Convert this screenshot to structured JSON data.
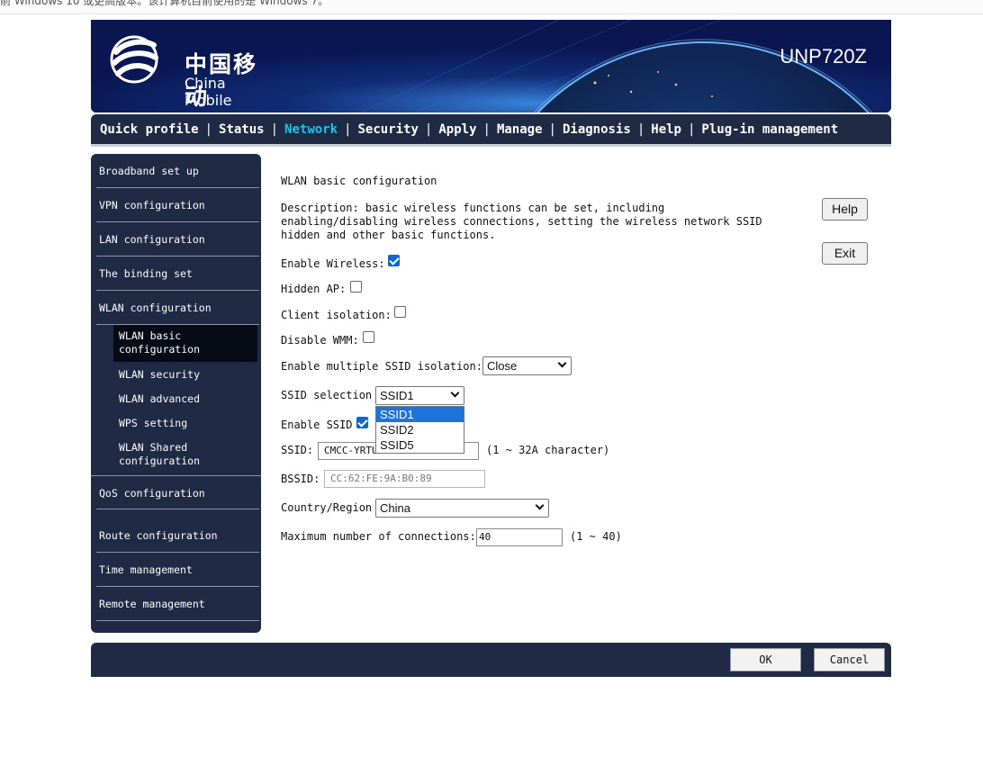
{
  "notice": {
    "text": "前 Windows 10 或更高版本。该计算机目前使用的是 Windows 7。"
  },
  "banner": {
    "brand_cn": "中国移动",
    "brand_en": "China Mobile",
    "model": "UNP720Z",
    "colors": {
      "background": "#0b1a5e",
      "glow": "#4aa8ff"
    }
  },
  "nav": {
    "items": [
      {
        "label": "Quick profile",
        "active": false
      },
      {
        "label": "Status",
        "active": false
      },
      {
        "label": "Network",
        "active": true
      },
      {
        "label": "Security",
        "active": false
      },
      {
        "label": "Apply",
        "active": false
      },
      {
        "label": "Manage",
        "active": false
      },
      {
        "label": "Diagnosis",
        "active": false
      },
      {
        "label": "Help",
        "active": false
      },
      {
        "label": "Plug-in management",
        "active": false
      }
    ],
    "separator": "|",
    "active_color": "#19c4ee"
  },
  "sidebar": {
    "items": [
      {
        "label": "Broadband set up"
      },
      {
        "label": "VPN configuration"
      },
      {
        "label": "LAN configuration"
      },
      {
        "label": "The binding set"
      },
      {
        "label": "WLAN configuration"
      },
      {
        "label": "QoS configuration"
      },
      {
        "label": "Route configuration"
      },
      {
        "label": "Time management"
      },
      {
        "label": "Remote management"
      }
    ],
    "subitems": [
      {
        "label": "WLAN basic configuration",
        "active": true
      },
      {
        "label": "WLAN security",
        "active": false
      },
      {
        "label": "WLAN advanced",
        "active": false
      },
      {
        "label": "WPS setting",
        "active": false
      },
      {
        "label": "WLAN Shared configuration",
        "active": false
      }
    ]
  },
  "main": {
    "title": "WLAN basic configuration",
    "description": "Description: basic wireless functions can be set, including enabling/disabling wireless connections, setting the wireless network SSID hidden and other basic functions.",
    "help_label": "Help",
    "exit_label": "Exit",
    "enable_wireless": {
      "label": "Enable Wireless:",
      "checked": true
    },
    "hidden_ap": {
      "label": "Hidden AP:",
      "checked": false
    },
    "client_isolation": {
      "label": "Client isolation:",
      "checked": false
    },
    "disable_wmm": {
      "label": "Disable WMM:",
      "checked": false
    },
    "ssid_isolation": {
      "label": "Enable multiple SSID isolation:",
      "value": "Close"
    },
    "ssid_selection": {
      "label": "SSID selection",
      "value": "SSID1",
      "options": [
        "SSID1",
        "SSID2",
        "SSID5"
      ],
      "highlighted": "SSID1"
    },
    "enable_ssid": {
      "label": "Enable SSID",
      "checked": true
    },
    "ssid": {
      "label": "SSID:",
      "value": "CMCC-YRTU",
      "hint": "(1 ~ 32A character)"
    },
    "bssid": {
      "label": "BSSID:",
      "value": "CC:62:FE:9A:B0:89"
    },
    "country": {
      "label": "Country/Region",
      "value": "China"
    },
    "max_conn": {
      "label": "Maximum number of connections:",
      "value": "40",
      "hint": "(1 ~ 40)"
    }
  },
  "footer": {
    "ok_label": "OK",
    "cancel_label": "Cancel"
  }
}
